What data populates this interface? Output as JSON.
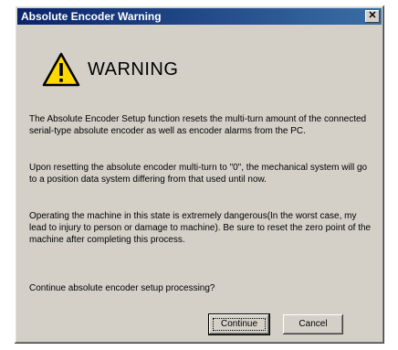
{
  "window": {
    "title": "Absolute Encoder Warning",
    "close_glyph": "✕"
  },
  "warning": {
    "icon": "warning-triangle-icon",
    "heading": "WARNING"
  },
  "paragraphs": {
    "p1": "The Absolute Encoder Setup function resets the multi-turn amount of the connected serial-type absolute encoder as well as encoder alarms from the PC.",
    "p2": "Upon resetting the absolute encoder multi-turn to \"0\", the mechanical system will go to a position data system differing from that used until now.",
    "p3": "Operating the machine in this state is extremely dangerous(In the worst case, my lead to injury to person or damage to machine). Be sure to reset the zero point of the machine after completing this process.",
    "p4": "Continue absolute encoder setup processing?"
  },
  "buttons": {
    "continue": "Continue",
    "cancel": "Cancel"
  },
  "colors": {
    "titlebar_start": "#0a246a",
    "titlebar_end": "#3a6ea5",
    "dialog_face": "#d4d0c8",
    "warning_yellow": "#ffd800"
  }
}
